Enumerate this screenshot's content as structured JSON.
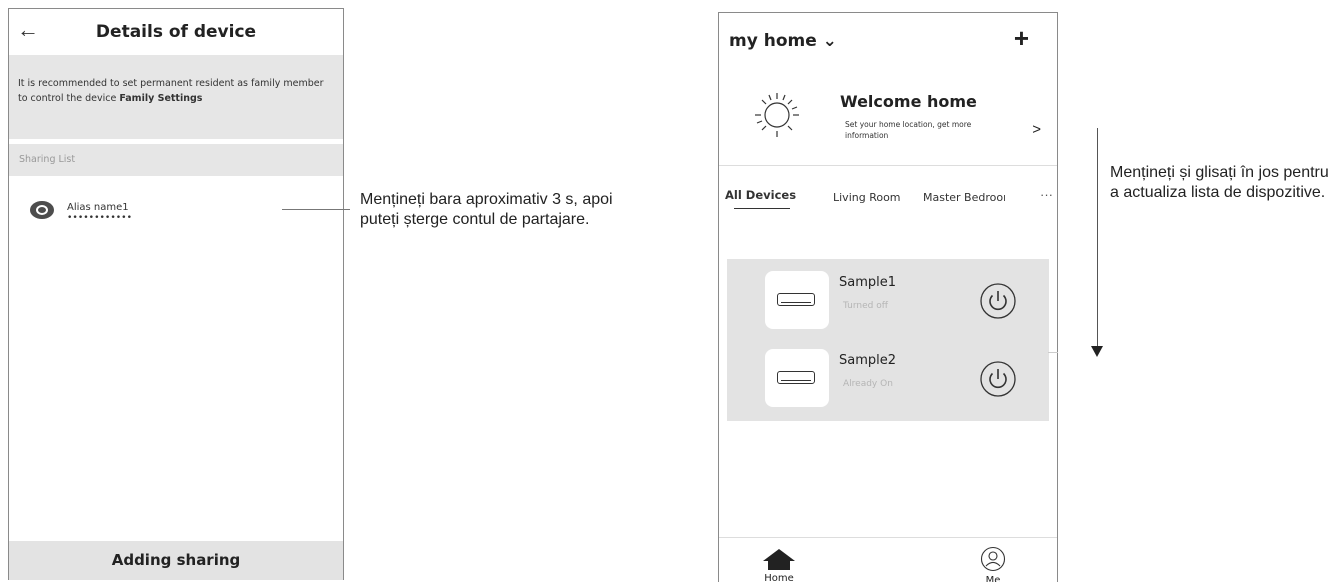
{
  "left_screen": {
    "back_icon": "back-arrow-icon",
    "title": "Details of device",
    "notice_text": "It is recommended to set permanent resident as family member to control the device ",
    "notice_link": "Family Settings",
    "sharing_list_label": "Sharing List",
    "share_item": {
      "name": "Alias name1",
      "masked": "••••••••••••"
    },
    "adding_button": "Adding sharing"
  },
  "callout_left": "Mențineți bara aproximativ 3 s, apoi puteți șterge contul de partajare.",
  "right_screen": {
    "home_title": "my home ⌄",
    "add_icon": "+",
    "welcome_title": "Welcome home",
    "welcome_sub": "Set your home location, get more information",
    "welcome_arrow": ">",
    "tabs": [
      {
        "label": "All Devices"
      },
      {
        "label": "Living Room"
      },
      {
        "label": "Master Bedroom"
      }
    ],
    "tab_more": "···",
    "devices": [
      {
        "name": "Sample1",
        "status": "Turned off"
      },
      {
        "name": "Sample2",
        "status": "Already On"
      }
    ],
    "nav": [
      {
        "label": "Home",
        "icon": "home-icon"
      },
      {
        "label": "Me",
        "icon": "profile-icon"
      }
    ]
  },
  "callout_right": "Mențineți și glisați în jos pentru a actualiza lista de dispozitive."
}
